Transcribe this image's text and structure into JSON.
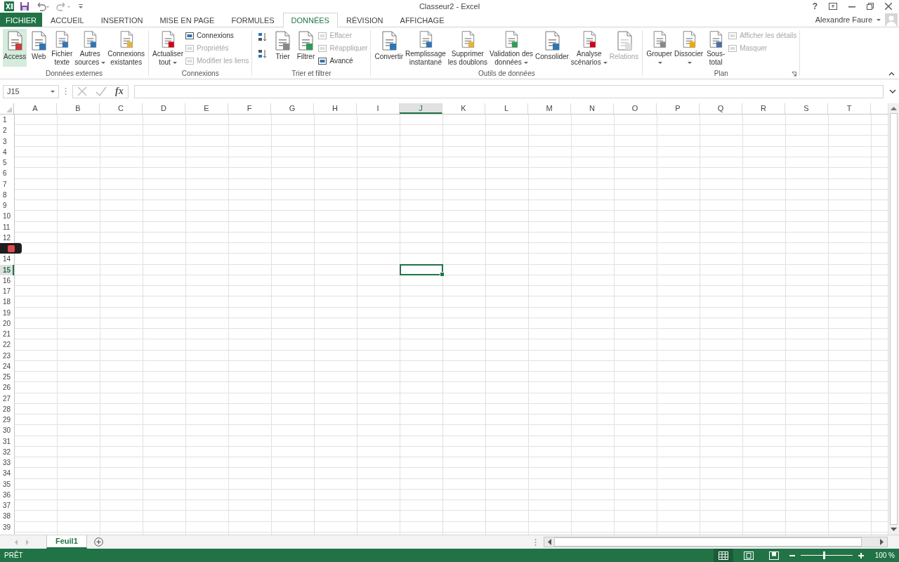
{
  "window": {
    "title": "Classeur2 - Excel",
    "help": "?",
    "user": "Alexandre Faure"
  },
  "tabs": [
    {
      "label": "FICHIER",
      "kind": "file",
      "selected": false
    },
    {
      "label": "ACCUEIL",
      "kind": "tab",
      "selected": false
    },
    {
      "label": "INSERTION",
      "kind": "tab",
      "selected": false
    },
    {
      "label": "MISE EN PAGE",
      "kind": "tab",
      "selected": false
    },
    {
      "label": "FORMULES",
      "kind": "tab",
      "selected": false
    },
    {
      "label": "DONNÉES",
      "kind": "tab",
      "selected": true
    },
    {
      "label": "RÉVISION",
      "kind": "tab",
      "selected": false
    },
    {
      "label": "AFFICHAGE",
      "kind": "tab",
      "selected": false
    }
  ],
  "ribbon": {
    "groups": [
      {
        "label": "Données externes",
        "items": [
          {
            "kind": "large",
            "lines": [
              "Access"
            ],
            "hovered": true,
            "disabled": false,
            "dropdown": false
          },
          {
            "kind": "large",
            "lines": [
              "Web"
            ],
            "hovered": false,
            "disabled": false,
            "dropdown": false
          },
          {
            "kind": "large",
            "lines": [
              "Fichier",
              "texte"
            ],
            "hovered": false,
            "disabled": false,
            "dropdown": false
          },
          {
            "kind": "large",
            "lines": [
              "Autres",
              "sources"
            ],
            "hovered": false,
            "disabled": false,
            "dropdown": true
          },
          {
            "kind": "large",
            "lines": [
              "Connexions",
              "existantes"
            ],
            "hovered": false,
            "disabled": false,
            "dropdown": false
          }
        ]
      },
      {
        "label": "Connexions",
        "items": [
          {
            "kind": "large",
            "lines": [
              "Actualiser",
              "tout"
            ],
            "hovered": false,
            "disabled": false,
            "dropdown": true
          },
          {
            "kind": "stack",
            "items": [
              {
                "label": "Connexions",
                "disabled": false
              },
              {
                "label": "Propriétés",
                "disabled": true
              },
              {
                "label": "Modifier les liens",
                "disabled": true
              }
            ]
          }
        ]
      },
      {
        "label": "Trier et filtrer",
        "items": [
          {
            "kind": "sort"
          },
          {
            "kind": "large",
            "lines": [
              "Trier"
            ],
            "hovered": false,
            "disabled": false,
            "dropdown": false
          },
          {
            "kind": "large",
            "lines": [
              "Filtrer"
            ],
            "hovered": false,
            "disabled": false,
            "dropdown": false
          },
          {
            "kind": "stack",
            "items": [
              {
                "label": "Effacer",
                "disabled": true
              },
              {
                "label": "Réappliquer",
                "disabled": true
              },
              {
                "label": "Avancé",
                "disabled": false
              }
            ]
          }
        ]
      },
      {
        "label": "Outils de données",
        "items": [
          {
            "kind": "large",
            "lines": [
              "Convertir"
            ],
            "hovered": false,
            "disabled": false,
            "dropdown": false
          },
          {
            "kind": "large",
            "lines": [
              "Remplissage",
              "instantané"
            ],
            "hovered": false,
            "disabled": false,
            "dropdown": false
          },
          {
            "kind": "large",
            "lines": [
              "Supprimer",
              "les doublons"
            ],
            "hovered": false,
            "disabled": false,
            "dropdown": false
          },
          {
            "kind": "large",
            "lines": [
              "Validation des",
              "données"
            ],
            "hovered": false,
            "disabled": false,
            "dropdown": true
          },
          {
            "kind": "large",
            "lines": [
              "Consolider"
            ],
            "hovered": false,
            "disabled": false,
            "dropdown": false
          },
          {
            "kind": "large",
            "lines": [
              "Analyse",
              "scénarios"
            ],
            "hovered": false,
            "disabled": false,
            "dropdown": true
          },
          {
            "kind": "large",
            "lines": [
              "Relations"
            ],
            "hovered": false,
            "disabled": true,
            "dropdown": false
          }
        ]
      },
      {
        "label": "Plan",
        "launcher": true,
        "items": [
          {
            "kind": "large",
            "lines": [
              "Grouper"
            ],
            "hovered": false,
            "disabled": false,
            "dropdown": true
          },
          {
            "kind": "large",
            "lines": [
              "Dissocier"
            ],
            "hovered": false,
            "disabled": false,
            "dropdown": true
          },
          {
            "kind": "large",
            "lines": [
              "Sous-",
              "total"
            ],
            "hovered": false,
            "disabled": false,
            "dropdown": false
          },
          {
            "kind": "stack",
            "items": [
              {
                "label": "Afficher les détails",
                "disabled": true
              },
              {
                "label": "Masquer",
                "disabled": true
              }
            ]
          }
        ]
      }
    ]
  },
  "formula_bar": {
    "name_box": "J15",
    "function_button": "fx"
  },
  "columns": [
    {
      "label": "A",
      "selected": false
    },
    {
      "label": "B",
      "selected": false
    },
    {
      "label": "C",
      "selected": false
    },
    {
      "label": "D",
      "selected": false
    },
    {
      "label": "E",
      "selected": false
    },
    {
      "label": "F",
      "selected": false
    },
    {
      "label": "G",
      "selected": false
    },
    {
      "label": "H",
      "selected": false
    },
    {
      "label": "I",
      "selected": false
    },
    {
      "label": "J",
      "selected": true
    },
    {
      "label": "K",
      "selected": false
    },
    {
      "label": "L",
      "selected": false
    },
    {
      "label": "M",
      "selected": false
    },
    {
      "label": "N",
      "selected": false
    },
    {
      "label": "O",
      "selected": false
    },
    {
      "label": "P",
      "selected": false
    },
    {
      "label": "Q",
      "selected": false
    },
    {
      "label": "R",
      "selected": false
    },
    {
      "label": "S",
      "selected": false
    },
    {
      "label": "T",
      "selected": false
    }
  ],
  "rows": [
    {
      "label": "1",
      "selected": false
    },
    {
      "label": "2",
      "selected": false
    },
    {
      "label": "3",
      "selected": false
    },
    {
      "label": "4",
      "selected": false
    },
    {
      "label": "5",
      "selected": false
    },
    {
      "label": "6",
      "selected": false
    },
    {
      "label": "7",
      "selected": false
    },
    {
      "label": "8",
      "selected": false
    },
    {
      "label": "9",
      "selected": false
    },
    {
      "label": "10",
      "selected": false
    },
    {
      "label": "11",
      "selected": false
    },
    {
      "label": "12",
      "selected": false
    },
    {
      "covered": true
    },
    {
      "label": "14",
      "selected": false
    },
    {
      "label": "15",
      "selected": true
    },
    {
      "label": "16",
      "selected": false
    },
    {
      "label": "17",
      "selected": false
    },
    {
      "label": "18",
      "selected": false
    },
    {
      "label": "19",
      "selected": false
    },
    {
      "label": "20",
      "selected": false
    },
    {
      "label": "21",
      "selected": false
    },
    {
      "label": "22",
      "selected": false
    },
    {
      "label": "23",
      "selected": false
    },
    {
      "label": "24",
      "selected": false
    },
    {
      "label": "25",
      "selected": false
    },
    {
      "label": "26",
      "selected": false
    },
    {
      "label": "27",
      "selected": false
    },
    {
      "label": "28",
      "selected": false
    },
    {
      "label": "29",
      "selected": false
    },
    {
      "label": "30",
      "selected": false
    },
    {
      "label": "31",
      "selected": false
    },
    {
      "label": "32",
      "selected": false
    },
    {
      "label": "33",
      "selected": false
    },
    {
      "label": "34",
      "selected": false
    },
    {
      "label": "35",
      "selected": false
    },
    {
      "label": "36",
      "selected": false
    },
    {
      "label": "37",
      "selected": false
    },
    {
      "label": "38",
      "selected": false
    },
    {
      "label": "39",
      "selected": false
    }
  ],
  "sheets": [
    {
      "label": "Feuil1",
      "selected": true
    }
  ],
  "status_bar": {
    "status": "PRÊT",
    "views": [
      {
        "selected": true
      },
      {
        "selected": false
      },
      {
        "selected": false
      }
    ],
    "zoom": {
      "level": 0.45,
      "reading": "100 %"
    }
  }
}
